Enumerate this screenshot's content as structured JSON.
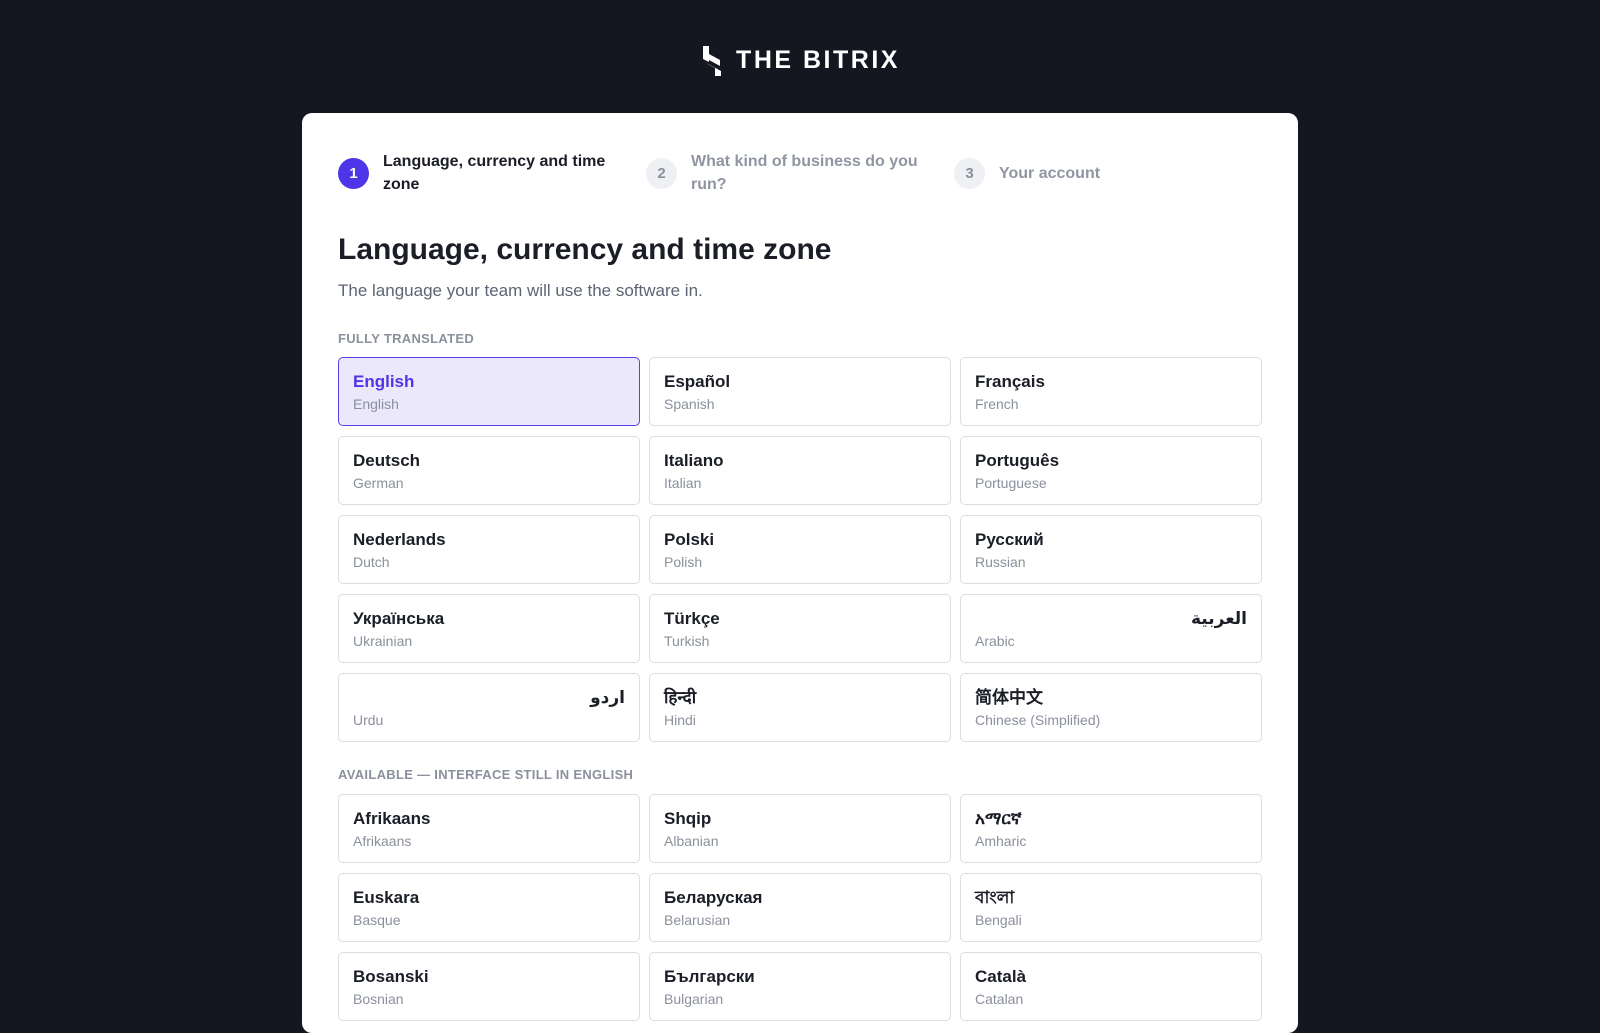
{
  "brand": {
    "name": "THE BITRIX"
  },
  "stepper": [
    {
      "number": "1",
      "label": "Language, currency and time zone",
      "state": "active"
    },
    {
      "number": "2",
      "label": "What kind of business do you run?",
      "state": "inactive"
    },
    {
      "number": "3",
      "label": "Your account",
      "state": "inactive"
    }
  ],
  "page": {
    "title": "Language, currency and time zone",
    "subtitle": "The language your team will use the software in."
  },
  "sections": {
    "fully_translated": "FULLY TRANSLATED",
    "available": "AVAILABLE — INTERFACE STILL IN ENGLISH"
  },
  "fully_translated": [
    {
      "native": "English",
      "english": "English",
      "selected": true
    },
    {
      "native": "Español",
      "english": "Spanish"
    },
    {
      "native": "Français",
      "english": "French"
    },
    {
      "native": "Deutsch",
      "english": "German"
    },
    {
      "native": "Italiano",
      "english": "Italian"
    },
    {
      "native": "Português",
      "english": "Portuguese"
    },
    {
      "native": "Nederlands",
      "english": "Dutch"
    },
    {
      "native": "Polski",
      "english": "Polish"
    },
    {
      "native": "Русский",
      "english": "Russian"
    },
    {
      "native": "Українська",
      "english": "Ukrainian"
    },
    {
      "native": "Türkçe",
      "english": "Turkish"
    },
    {
      "native": "العربية",
      "english": "Arabic",
      "rtl": true
    },
    {
      "native": "اردو",
      "english": "Urdu",
      "rtl": true
    },
    {
      "native": "हिन्दी",
      "english": "Hindi"
    },
    {
      "native": "简体中文",
      "english": "Chinese (Simplified)"
    }
  ],
  "available": [
    {
      "native": "Afrikaans",
      "english": "Afrikaans"
    },
    {
      "native": "Shqip",
      "english": "Albanian"
    },
    {
      "native": "አማርኛ",
      "english": "Amharic"
    },
    {
      "native": "Euskara",
      "english": "Basque"
    },
    {
      "native": "Беларуская",
      "english": "Belarusian"
    },
    {
      "native": "বাংলা",
      "english": "Bengali"
    },
    {
      "native": "Bosanski",
      "english": "Bosnian"
    },
    {
      "native": "Български",
      "english": "Bulgarian"
    },
    {
      "native": "Català",
      "english": "Catalan"
    }
  ],
  "colors": {
    "background": "#141720",
    "accent": "#4f35e8",
    "selected_fill": "#ebe8fc"
  }
}
